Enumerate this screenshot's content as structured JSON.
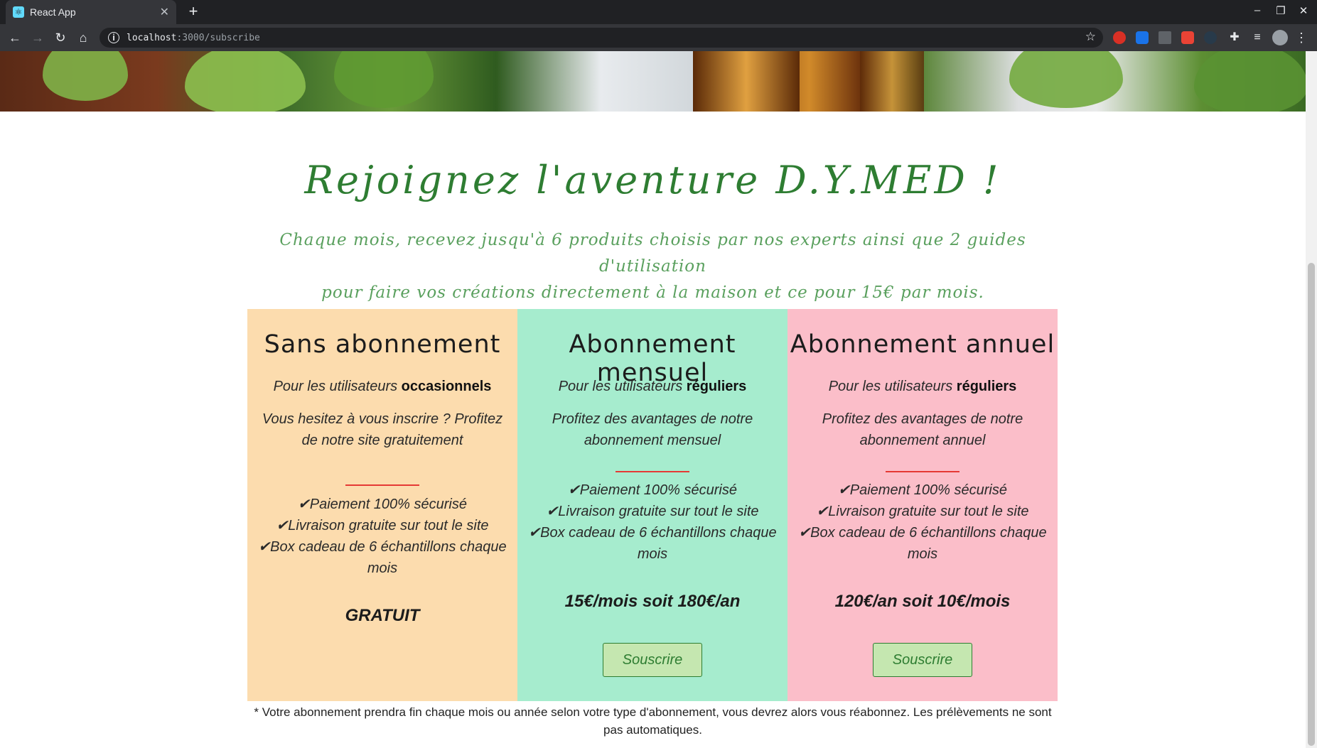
{
  "browser": {
    "tab_title": "React App",
    "tab_close": "✕",
    "new_tab": "+",
    "url_host": "localhost",
    "url_path": ":3000/subscribe",
    "window_controls": [
      "–",
      "❐",
      "✕"
    ]
  },
  "page": {
    "title": "Rejoignez l'aventure D.Y.MED !",
    "subtitle_line1": "Chaque mois, recevez jusqu'à 6 produits choisis par nos experts ainsi que 2 guides d'utilisation",
    "subtitle_line2": "pour faire vos créations directement à la maison et ce pour 15€ par mois.",
    "plans": [
      {
        "name": "Sans abonnement",
        "audience_prefix": "Pour les utilisateurs ",
        "audience_bold": "occasionnels",
        "description": "Vous hesitez à vous inscrire ? Profitez de notre site gratuitement",
        "features": [
          "✔Paiement 100% sécurisé",
          "✔Livraison gratuite sur tout le site",
          "✔Box cadeau de 6 échantillons chaque mois"
        ],
        "price": "GRATUIT"
      },
      {
        "name": "Abonnement mensuel",
        "audience_prefix": "Pour les utilisateurs ",
        "audience_bold": "réguliers",
        "description": "Profitez des avantages de notre abonnement mensuel",
        "features": [
          "✔Paiement 100% sécurisé",
          "✔Livraison gratuite sur tout le site",
          "✔Box cadeau de 6 échantillons chaque mois"
        ],
        "price": "15€/mois soit 180€/an",
        "button": "Souscrire"
      },
      {
        "name": "Abonnement annuel",
        "audience_prefix": "Pour les utilisateurs ",
        "audience_bold": "réguliers",
        "description": "Profitez des avantages de notre abonnement annuel",
        "features": [
          "✔Paiement 100% sécurisé",
          "✔Livraison gratuite sur tout le site",
          "✔Box cadeau de 6 échantillons chaque mois"
        ],
        "price": "120€/an soit 10€/mois",
        "button": "Souscrire"
      }
    ],
    "footnote": "* Votre abonnement prendra fin chaque mois ou année selon votre type d'abonnement, vous devrez alors vous réabonnez. Les prélèvements ne sont pas automatiques."
  },
  "colors": {
    "title_green": "#2e7d32",
    "subtitle_green": "#5aa05e",
    "plan_orange": "#fcdcae",
    "plan_mint": "#a6ecce",
    "plan_pink": "#fbbec9",
    "divider_red": "#e53935",
    "button_bg": "#c5e7b0"
  }
}
